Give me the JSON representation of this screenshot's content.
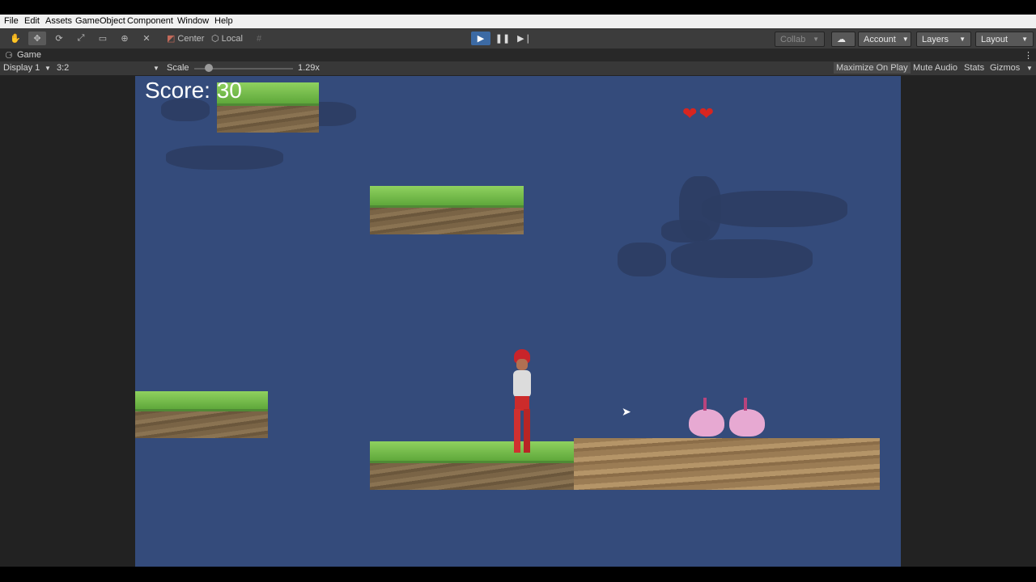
{
  "menu": [
    "File",
    "Edit",
    "Assets",
    "GameObject",
    "Component",
    "Window",
    "Help"
  ],
  "toolbar": {
    "tools": [
      "hand-tool",
      "move-tool",
      "rotate-tool",
      "scale-tool",
      "rect-tool",
      "transform-tool",
      "custom-tool"
    ],
    "active_tool": "move-tool",
    "pivot_mode": "Center",
    "pivot_rotation": "Local",
    "collab": "Collab",
    "account": "Account",
    "layers": "Layers",
    "layout": "Layout"
  },
  "game_view": {
    "tab": "Game",
    "display": "Display 1",
    "aspect": "3:2",
    "scale_label": "Scale",
    "scale_value": "1.29x",
    "scale_fraction": 0.15,
    "maximize": "Maximize On Play",
    "mute": "Mute Audio",
    "stats": "Stats",
    "gizmos": "Gizmos"
  },
  "hud": {
    "score": "Score: 30",
    "lives": 2
  },
  "colors": {
    "sky": "#344b7b",
    "play_accent": "#3c6aa4",
    "heart": "#d8251f"
  }
}
